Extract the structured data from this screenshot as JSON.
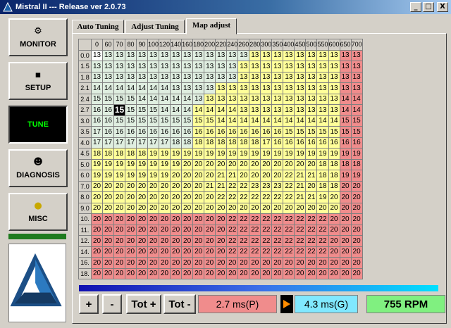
{
  "window": {
    "title": "Mistral II --- Release ver 2.0.73",
    "buttons": [
      "_",
      "□",
      "X"
    ]
  },
  "sidebar": {
    "items": [
      {
        "label": "MONITOR",
        "icon": "⚙",
        "icon_name": "gear-icon",
        "active": false
      },
      {
        "label": "SETUP",
        "icon": "▪",
        "icon_name": "chip-icon",
        "active": false
      },
      {
        "label": "TUNE",
        "icon": "",
        "icon_name": "",
        "active": true
      },
      {
        "label": "DIAGNOSIS",
        "icon": "☻",
        "icon_name": "diagnosis-icon",
        "active": false
      },
      {
        "label": "MISC",
        "icon": "●",
        "icon_name": "coin-icon",
        "active": false
      }
    ]
  },
  "tabs": [
    {
      "label": "Auto Tuning",
      "active": false
    },
    {
      "label": "Adjust Tuning",
      "active": false
    },
    {
      "label": "Map adjust",
      "active": true
    }
  ],
  "map": {
    "corner": "",
    "rpm": [
      "0",
      "60",
      "70",
      "80",
      "90",
      "100",
      "120",
      "140",
      "160",
      "180",
      "200",
      "220",
      "240",
      "260",
      "280",
      "300",
      "350",
      "400",
      "450",
      "500",
      "550",
      "600",
      "650",
      "700"
    ],
    "load": [
      "0.0",
      "1.5",
      "1.8",
      "2.1",
      "2.4",
      "2.7",
      "3.0",
      "3.5",
      "4.0",
      "4.5",
      "5.0",
      "6.0",
      "7.0",
      "8.0",
      "9.0",
      "10.",
      "11.",
      "12.",
      "14.",
      "16.",
      "18."
    ],
    "selected": {
      "row": 5,
      "col": 2
    },
    "colors": {
      "lean": "#dfeee0",
      "mid": "#ffff99",
      "rich": "#f08c8c",
      "selected": "#000000"
    },
    "values": [
      [
        13,
        13,
        13,
        13,
        13,
        13,
        13,
        13,
        13,
        13,
        13,
        13,
        13,
        13,
        13,
        13,
        13,
        13,
        13,
        13,
        13,
        13,
        13,
        13
      ],
      [
        13,
        13,
        13,
        13,
        13,
        13,
        13,
        13,
        13,
        13,
        13,
        13,
        13,
        13,
        13,
        13,
        13,
        13,
        13,
        13,
        13,
        13,
        13,
        13
      ],
      [
        13,
        13,
        13,
        13,
        13,
        13,
        13,
        13,
        13,
        13,
        13,
        13,
        13,
        13,
        13,
        13,
        13,
        13,
        13,
        13,
        13,
        13,
        13,
        13
      ],
      [
        14,
        14,
        14,
        14,
        14,
        14,
        14,
        13,
        13,
        13,
        13,
        13,
        13,
        13,
        13,
        13,
        13,
        13,
        13,
        13,
        13,
        13,
        13,
        13
      ],
      [
        15,
        15,
        15,
        15,
        14,
        14,
        14,
        14,
        14,
        13,
        13,
        13,
        13,
        13,
        13,
        13,
        13,
        13,
        13,
        13,
        13,
        13,
        14,
        14
      ],
      [
        16,
        16,
        15,
        15,
        15,
        15,
        14,
        14,
        14,
        14,
        14,
        14,
        14,
        13,
        13,
        13,
        13,
        13,
        13,
        13,
        13,
        13,
        14,
        14
      ],
      [
        16,
        16,
        15,
        15,
        15,
        15,
        15,
        15,
        15,
        15,
        15,
        14,
        14,
        14,
        14,
        14,
        14,
        14,
        14,
        14,
        14,
        14,
        15,
        15
      ],
      [
        17,
        16,
        16,
        16,
        16,
        16,
        16,
        16,
        16,
        16,
        16,
        16,
        16,
        16,
        16,
        16,
        16,
        15,
        15,
        15,
        15,
        15,
        15,
        15
      ],
      [
        17,
        17,
        17,
        17,
        17,
        17,
        17,
        18,
        18,
        18,
        18,
        18,
        18,
        18,
        18,
        17,
        16,
        16,
        16,
        16,
        16,
        16,
        16,
        16
      ],
      [
        18,
        18,
        18,
        18,
        18,
        19,
        19,
        19,
        19,
        19,
        19,
        19,
        19,
        19,
        19,
        19,
        19,
        19,
        19,
        19,
        19,
        19,
        19,
        19
      ],
      [
        19,
        19,
        19,
        19,
        19,
        19,
        19,
        19,
        20,
        20,
        20,
        20,
        20,
        20,
        20,
        20,
        20,
        20,
        20,
        20,
        18,
        18,
        18,
        18
      ],
      [
        19,
        19,
        19,
        19,
        19,
        19,
        19,
        20,
        20,
        20,
        20,
        21,
        21,
        20,
        20,
        20,
        20,
        22,
        21,
        21,
        18,
        18,
        19,
        19
      ],
      [
        20,
        20,
        20,
        20,
        20,
        20,
        20,
        20,
        20,
        20,
        21,
        21,
        22,
        22,
        23,
        23,
        23,
        22,
        21,
        20,
        18,
        18,
        20,
        20
      ],
      [
        20,
        20,
        20,
        20,
        20,
        20,
        20,
        20,
        20,
        20,
        20,
        22,
        22,
        22,
        22,
        22,
        22,
        22,
        21,
        21,
        19,
        20,
        20,
        20
      ],
      [
        20,
        20,
        20,
        20,
        20,
        20,
        20,
        20,
        20,
        20,
        20,
        20,
        20,
        20,
        20,
        20,
        20,
        20,
        20,
        20,
        20,
        20,
        20,
        20
      ],
      [
        20,
        20,
        20,
        20,
        20,
        20,
        20,
        20,
        20,
        20,
        20,
        20,
        22,
        22,
        22,
        22,
        22,
        22,
        22,
        22,
        22,
        20,
        20,
        20
      ],
      [
        20,
        20,
        20,
        20,
        20,
        20,
        20,
        20,
        20,
        20,
        20,
        20,
        22,
        22,
        22,
        22,
        22,
        22,
        22,
        22,
        22,
        20,
        20,
        20
      ],
      [
        20,
        20,
        20,
        20,
        20,
        20,
        20,
        20,
        20,
        20,
        20,
        20,
        22,
        22,
        22,
        22,
        22,
        22,
        22,
        22,
        22,
        20,
        20,
        20
      ],
      [
        20,
        20,
        20,
        20,
        20,
        20,
        20,
        20,
        20,
        20,
        20,
        20,
        22,
        22,
        22,
        22,
        22,
        22,
        22,
        22,
        22,
        20,
        20,
        20
      ],
      [
        20,
        20,
        20,
        20,
        20,
        20,
        20,
        20,
        20,
        20,
        20,
        20,
        20,
        20,
        20,
        20,
        20,
        20,
        20,
        20,
        20,
        20,
        20,
        20
      ],
      [
        20,
        20,
        20,
        20,
        20,
        20,
        20,
        20,
        20,
        20,
        20,
        20,
        20,
        20,
        20,
        20,
        20,
        20,
        20,
        20,
        20,
        20,
        20,
        20
      ]
    ],
    "zones": [
      "wgggggggggggggyyyyyyyyrr",
      "gggggggggggggyyyyyyyyyrr",
      "gggggggggggggyyyyyyyyyrr",
      "gggggggggggyyyyyyyyyyyrr",
      "ggggggggggyyyyyyyyyyyyrr",
      "gg ggggggyyyyyyyyyyyyyrr",
      "gggggggggyyyyyyyyyyyyyrr",
      "gggggggggyyyyyyyyyyyyyrr",
      "gggggggggyyyyyyyyyyyyyrr",
      "yyyyyyyyyyyyyyyyyyyyyyrr",
      "yyyyyyyyyyyyyyyyyyyyyyrr",
      "yyyyyyyyyyyyyyyyyyyyyyrr",
      "yyyyyyyyyyyyyyyyyyyyyyrr",
      "yyyyyyyyyyyyyyyyyyyyyyrr",
      "yyyyyyyyyyyyyyyyyyyyyyrr",
      "rrrrrrrrrrrrrrrrrrrrrrrr",
      "rrrrrrrrrrrrrrrrrrrrrrrr",
      "rrrrrrrrrrrrrrrrrrrrrrrr",
      "rrrrrrrrrrrrrrrrrrrrrrrr",
      "rrrrrrrrrrrrrrrrrrrrrrrr",
      "rrrrrrrrrrrrrrrrrrrrrrrr"
    ]
  },
  "controls": {
    "plus": "+",
    "minus": "-",
    "tot_plus": "Tot +",
    "tot_minus": "Tot -",
    "pump_time": "2.7 ms(P)",
    "gas_time": "4.3 ms(G)",
    "rpm": "755 RPM",
    "colors": {
      "pump": "#f08c8c",
      "gas": "#80e8ff",
      "rpm": "#80f080"
    }
  }
}
